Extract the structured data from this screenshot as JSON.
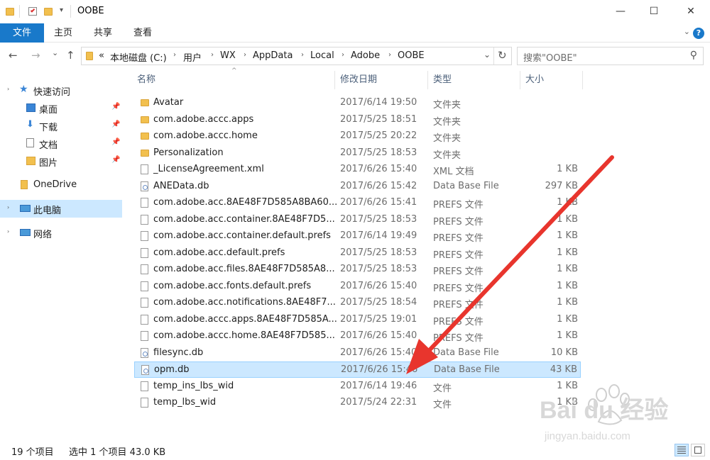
{
  "window": {
    "title": "OOBE",
    "controls": {
      "minimize": "—",
      "maximize": "☐",
      "close": "✕"
    }
  },
  "ribbon": {
    "tabs": [
      {
        "label": "文件",
        "active": true
      },
      {
        "label": "主页",
        "active": false
      },
      {
        "label": "共享",
        "active": false
      },
      {
        "label": "查看",
        "active": false
      }
    ],
    "help": "?"
  },
  "navigation": {
    "back": "←",
    "forward": "→",
    "history": "⌄",
    "up": "↑",
    "breadcrumb": [
      "«",
      "本地磁盘 (C:)",
      "用户",
      "WX",
      "AppData",
      "Local",
      "Adobe",
      "OOBE"
    ],
    "search_placeholder": "搜索\"OOBE\""
  },
  "nav_pane": {
    "items": [
      {
        "label": "快速访问",
        "icon": "star-icon"
      },
      {
        "label": "桌面",
        "icon": "desktop-icon",
        "pinned": true
      },
      {
        "label": "下载",
        "icon": "download-icon",
        "pinned": true
      },
      {
        "label": "文档",
        "icon": "document-icon",
        "pinned": true
      },
      {
        "label": "图片",
        "icon": "picture-icon",
        "pinned": true
      },
      {
        "label": "OneDrive",
        "icon": "onedrive-icon"
      },
      {
        "label": "此电脑",
        "icon": "computer-icon",
        "selected": true
      },
      {
        "label": "网络",
        "icon": "network-icon"
      }
    ]
  },
  "columns": {
    "name": "名称",
    "date": "修改日期",
    "type": "类型",
    "size": "大小"
  },
  "files": [
    {
      "name": "Avatar",
      "date": "2017/6/14 19:50",
      "type": "文件夹",
      "size": "",
      "kind": "folder"
    },
    {
      "name": "com.adobe.accc.apps",
      "date": "2017/5/25 18:51",
      "type": "文件夹",
      "size": "",
      "kind": "folder"
    },
    {
      "name": "com.adobe.accc.home",
      "date": "2017/5/25 20:22",
      "type": "文件夹",
      "size": "",
      "kind": "folder"
    },
    {
      "name": "Personalization",
      "date": "2017/5/25 18:53",
      "type": "文件夹",
      "size": "",
      "kind": "folder"
    },
    {
      "name": "_LicenseAgreement.xml",
      "date": "2017/6/26 15:40",
      "type": "XML 文档",
      "size": "1 KB",
      "kind": "file"
    },
    {
      "name": "ANEData.db",
      "date": "2017/6/26 15:42",
      "type": "Data Base File",
      "size": "297 KB",
      "kind": "db"
    },
    {
      "name": "com.adobe.acc.8AE48F7D585A8BA60...",
      "date": "2017/6/26 15:41",
      "type": "PREFS 文件",
      "size": "1 KB",
      "kind": "file"
    },
    {
      "name": "com.adobe.acc.container.8AE48F7D5...",
      "date": "2017/5/25 18:53",
      "type": "PREFS 文件",
      "size": "1 KB",
      "kind": "file"
    },
    {
      "name": "com.adobe.acc.container.default.prefs",
      "date": "2017/6/14 19:49",
      "type": "PREFS 文件",
      "size": "1 KB",
      "kind": "file"
    },
    {
      "name": "com.adobe.acc.default.prefs",
      "date": "2017/5/25 18:53",
      "type": "PREFS 文件",
      "size": "1 KB",
      "kind": "file"
    },
    {
      "name": "com.adobe.acc.files.8AE48F7D585A8...",
      "date": "2017/5/25 18:53",
      "type": "PREFS 文件",
      "size": "1 KB",
      "kind": "file"
    },
    {
      "name": "com.adobe.acc.fonts.default.prefs",
      "date": "2017/6/26 15:40",
      "type": "PREFS 文件",
      "size": "1 KB",
      "kind": "file"
    },
    {
      "name": "com.adobe.acc.notifications.8AE48F7...",
      "date": "2017/5/25 18:54",
      "type": "PREFS 文件",
      "size": "1 KB",
      "kind": "file"
    },
    {
      "name": "com.adobe.accc.apps.8AE48F7D585A...",
      "date": "2017/5/25 19:01",
      "type": "PREFS 文件",
      "size": "1 KB",
      "kind": "file"
    },
    {
      "name": "com.adobe.accc.home.8AE48F7D585...",
      "date": "2017/6/26 15:40",
      "type": "PREFS 文件",
      "size": "1 KB",
      "kind": "file"
    },
    {
      "name": "filesync.db",
      "date": "2017/6/26 15:40",
      "type": "Data Base File",
      "size": "10 KB",
      "kind": "db"
    },
    {
      "name": "opm.db",
      "date": "2017/6/26 15:46",
      "type": "Data Base File",
      "size": "43 KB",
      "kind": "db",
      "selected": true
    },
    {
      "name": "temp_ins_lbs_wid",
      "date": "2017/6/14 19:46",
      "type": "文件",
      "size": "1 KB",
      "kind": "file"
    },
    {
      "name": "temp_lbs_wid",
      "date": "2017/5/24 22:31",
      "type": "文件",
      "size": "1 KB",
      "kind": "file"
    }
  ],
  "status": {
    "count": "19 个项目",
    "selection": "选中 1 个项目 43.0 KB"
  },
  "watermark": {
    "brand_text": "Bai du 经验",
    "url": "jingyan.baidu.com"
  },
  "colors": {
    "accent": "#1979ca",
    "selection": "#cce8ff",
    "arrow": "#e8352d"
  }
}
